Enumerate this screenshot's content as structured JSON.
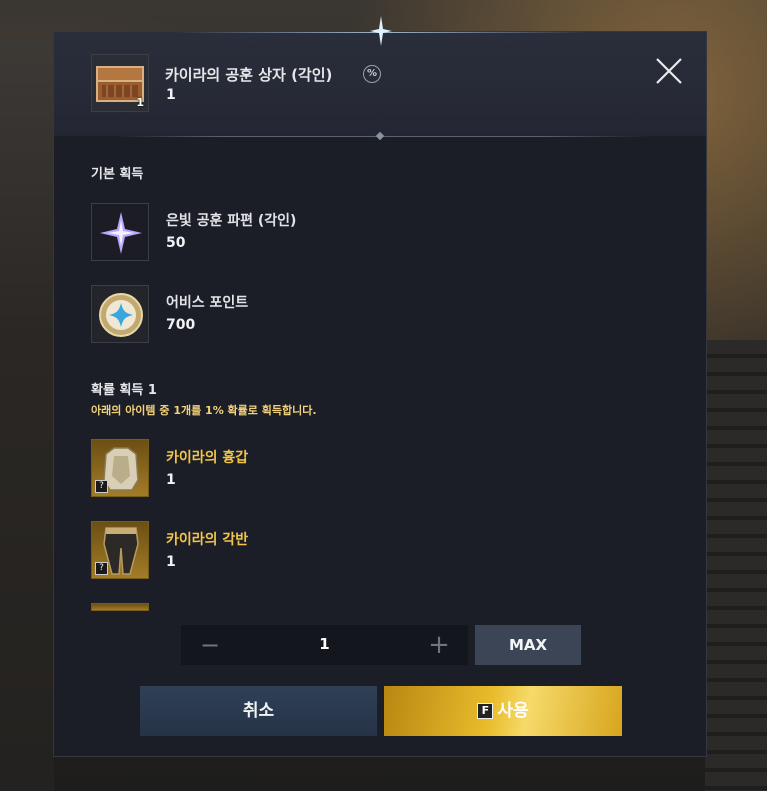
{
  "header": {
    "title": "카이라의 공훈 상자 (각인)",
    "count": "1",
    "badge_qty": "1",
    "info_glyph": "%"
  },
  "basic": {
    "heading": "기본 획득",
    "items": [
      {
        "name": "은빛 공훈 파편 (각인)",
        "count": "50"
      },
      {
        "name": "어비스 포인트",
        "count": "700"
      }
    ]
  },
  "chance": {
    "heading": "확률 획득 1",
    "description": "아래의 아이템 중 1개를 1% 확률로 획득합니다.",
    "items": [
      {
        "name": "카이라의 흉갑",
        "count": "1",
        "lock": "?"
      },
      {
        "name": "카이라의 각반",
        "count": "1",
        "lock": "?"
      }
    ]
  },
  "quantity": {
    "value": "1",
    "minus": "−",
    "plus": "+",
    "max_label": "MAX"
  },
  "actions": {
    "cancel_label": "취소",
    "use_key": "F",
    "use_label": "사용"
  },
  "icons": {
    "close": "close-icon",
    "info": "percent-info-icon"
  },
  "colors": {
    "gold_text": "#f1c54a",
    "dialog_bg": "#1c1e27",
    "use_button": "#e8bc2c"
  }
}
